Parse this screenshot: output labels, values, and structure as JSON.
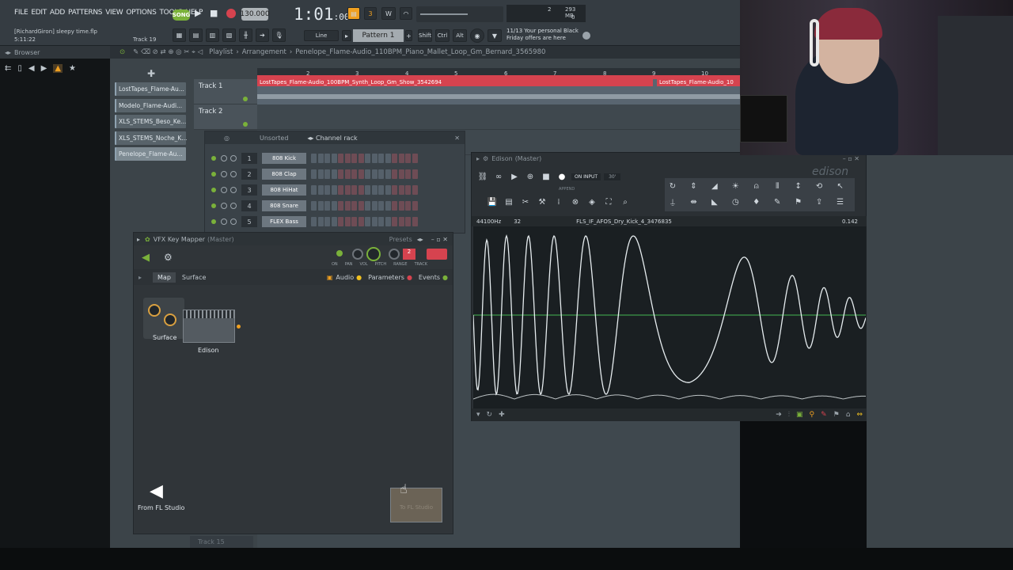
{
  "menu": [
    "FILE",
    "EDIT",
    "ADD",
    "PATTERNS",
    "VIEW",
    "OPTIONS",
    "TOOLS",
    "HELP"
  ],
  "transport": {
    "mode": "SONG",
    "tempo": "130.000",
    "time": "1:01",
    "time_sub": ":00",
    "cpu": "2",
    "mem": "293 MB",
    "poly": "0"
  },
  "project": {
    "user": "[RichardGiron]",
    "file": "sleepy time.flp",
    "elapsed": "5:11:22",
    "track_hint": "Track 19"
  },
  "toolbar": {
    "snap": "Line",
    "pattern": "Pattern 1",
    "shift": "Shift",
    "ctrl": "Ctrl",
    "alt": "Alt"
  },
  "news": {
    "date": "11/13",
    "line1": "Your personal Black",
    "line2": "Friday offers are here"
  },
  "browser": {
    "title": "Browser"
  },
  "playlist": {
    "title": "Playlist",
    "breadcrumb": "Arrangement",
    "pattern_name": "Penelope_Flame-Audio_110BPM_Piano_Mallet_Loop_Gm_Bernard_3565980",
    "ruler": [
      "2",
      "3",
      "4",
      "5",
      "6",
      "7",
      "8",
      "9",
      "10"
    ],
    "clip1": "LostTapes_Flame-Audio_100BPM_Synth_Loop_Gm_Show_3542694",
    "clip2": "LostTapes_Flame-Audio_10",
    "tracks": [
      "Track 1",
      "Track 2"
    ],
    "bottom_track": "Track 15"
  },
  "pattern_clips": [
    "LostTapes_Flame-Au...",
    "Modelo_Flame-Audi...",
    "XLS_STEMS_Beso_Ke...",
    "XLS_STEMS_Noche_K...",
    "Penelope_Flame-Au..."
  ],
  "channel_rack": {
    "filter": "Unsorted",
    "title": "Channel rack",
    "channels": [
      {
        "num": "1",
        "name": "808 Kick"
      },
      {
        "num": "2",
        "name": "808 Clap"
      },
      {
        "num": "3",
        "name": "808 HiHat"
      },
      {
        "num": "4",
        "name": "808 Snare"
      },
      {
        "num": "5",
        "name": "FLEX Bass"
      }
    ]
  },
  "vfx": {
    "title": "VFX Key Mapper",
    "owner": "(Master)",
    "presets": "Presets",
    "knobs": [
      "ON",
      "PAN",
      "VOL",
      "PITCH",
      "RANGE",
      "TRACK"
    ],
    "tabs": [
      "Map",
      "Surface"
    ],
    "toggles": [
      "Audio",
      "Parameters",
      "Events"
    ],
    "node1": "Surface",
    "node2": "Edison",
    "input": "From FL Studio",
    "output": "To FL Studio"
  },
  "edison": {
    "title": "Edison",
    "owner": "(Master)",
    "logo": "edison",
    "rec_mode": "ON INPUT",
    "rec_len": "30'",
    "append": "APPEND",
    "rate": "44100Hz",
    "bits": "32",
    "file": "FLS_IF_AFOS_Dry_Kick_4_3476835",
    "length": "0.142"
  },
  "colors": {
    "accent": "#d6434f",
    "green": "#7ab13a",
    "orange": "#f0a020"
  }
}
